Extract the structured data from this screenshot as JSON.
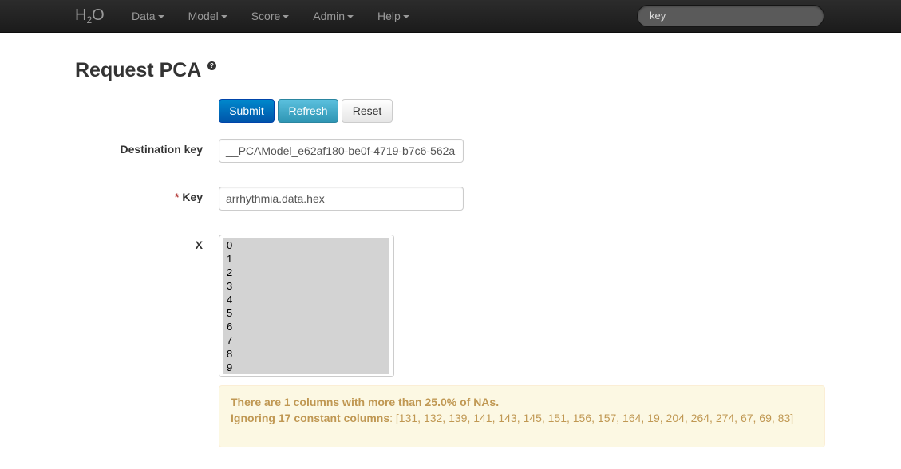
{
  "navbar": {
    "brand_main": "H",
    "brand_sub": "2",
    "brand_end": "O",
    "items": [
      {
        "label": "Data"
      },
      {
        "label": "Model"
      },
      {
        "label": "Score"
      },
      {
        "label": "Admin"
      },
      {
        "label": "Help"
      }
    ],
    "search_value": "key"
  },
  "page": {
    "title": "Request PCA",
    "help_icon": "?"
  },
  "buttons": {
    "submit": "Submit",
    "refresh": "Refresh",
    "reset": "Reset"
  },
  "form": {
    "destination_key_label": "Destination key",
    "destination_key_value": "__PCAModel_e62af180-be0f-4719-b7c6-562a",
    "key_required_mark": "*",
    "key_label": "Key",
    "key_value": "arrhythmia.data.hex",
    "x_label": "X",
    "x_options": [
      "0",
      "1",
      "2",
      "3",
      "4",
      "5",
      "6",
      "7",
      "8",
      "9"
    ]
  },
  "alert": {
    "line1": "There are 1 columns with more than 25.0% of NAs.",
    "line2_bold": "Ignoring 17 constant columns",
    "line2_rest": ": [131, 132, 139, 141, 143, 145, 151, 156, 157, 164, 19, 204, 264, 274, 67, 69, 83]"
  },
  "colors": {
    "navbar_bg": "#1b1b1b",
    "primary": "#0074cc",
    "info": "#49afcd",
    "warning_bg": "#fcf8e3",
    "warning_text": "#c09853",
    "required": "#b94a48"
  }
}
